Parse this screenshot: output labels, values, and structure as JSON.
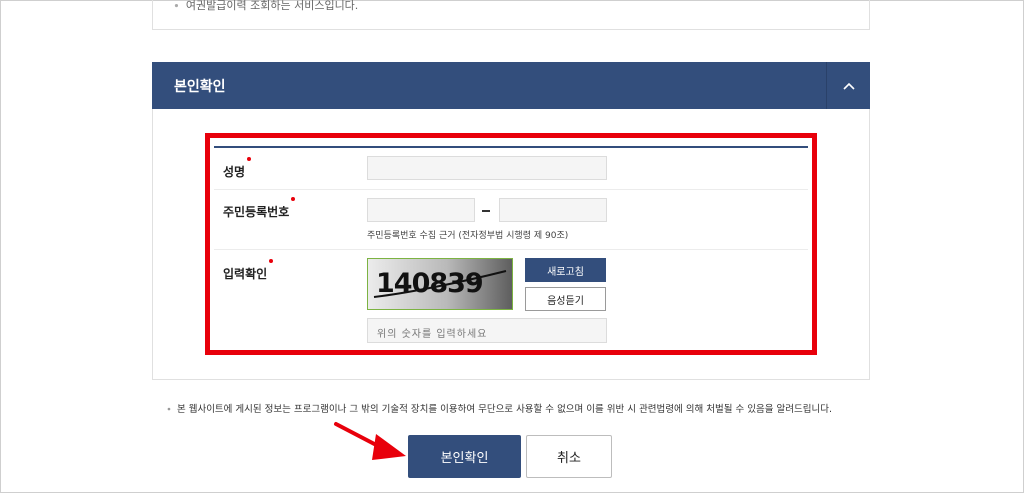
{
  "top_note": "여권발급이력 조회하는 서비스입니다.",
  "section": {
    "title": "본인확인",
    "collapse_icon": "chevron-up-icon"
  },
  "form": {
    "name_label": "성명",
    "rrn_label": "주민등록번호",
    "rrn_hint": "주민등록번호 수집 근거 (전자정부법 시행령 제 90조)",
    "captcha_label": "입력확인",
    "captcha_text": "140839",
    "refresh_label": "새로고침",
    "audio_label": "음성듣기",
    "captcha_placeholder": "위의 숫자를 입력하세요",
    "required_color": "#e8000b"
  },
  "notice": "본 웹사이트에 게시된 정보는 프로그램이나 그 밖의 기술적 장치를 이용하여 무단으로 사용할 수 없으며 이를 위반 시 관련법령에 의해 처벌될 수 있음을 알려드립니다.",
  "buttons": {
    "confirm_label": "본인확인",
    "cancel_label": "취소"
  },
  "colors": {
    "primary": "#334e7c",
    "highlight": "#e8000b"
  }
}
